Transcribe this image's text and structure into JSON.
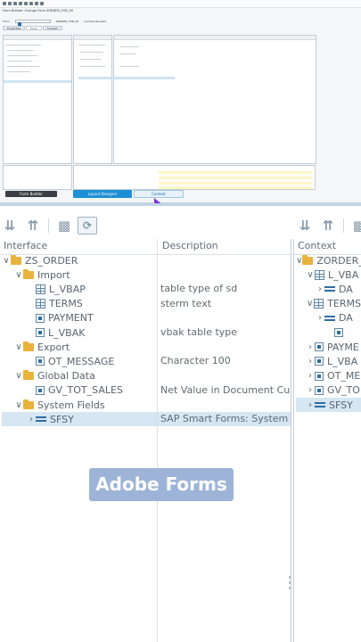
{
  "mini": {
    "title": "Form Builder: Change Form ZORDER_FOR_SS",
    "form_label": "Form",
    "form_value": "ZORDER_FOR_SS",
    "status": "Inactive Revised",
    "tabs": [
      "Properties",
      "Form",
      "Context"
    ],
    "buttons": {
      "back": "Form Builder",
      "layout": "Layout Designer",
      "context": "Context"
    }
  },
  "toolbar": {
    "interface_icons": [
      "collapse-all-icon",
      "expand-all-icon",
      "binoculars-icon",
      "refresh-icon"
    ],
    "context_icons": [
      "collapse-all-icon",
      "expand-all-icon",
      "binoculars-icon"
    ]
  },
  "columns": {
    "interface": "Interface",
    "description": "Description",
    "context": "Context"
  },
  "interface_tree": [
    {
      "label": "ZS_ORDER",
      "icon": "folder",
      "level": 0,
      "expander": "chevron-down",
      "description": ""
    },
    {
      "label": "Import",
      "icon": "folder",
      "level": 1,
      "expander": "chevron-down",
      "description": ""
    },
    {
      "label": "L_VBAP",
      "icon": "table",
      "level": 2,
      "expander": "",
      "description": "table type of sd"
    },
    {
      "label": "TERMS",
      "icon": "table",
      "level": 2,
      "expander": "",
      "description": "sterm text"
    },
    {
      "label": "PAYMENT",
      "icon": "field",
      "level": 2,
      "expander": "",
      "description": ""
    },
    {
      "label": "L_VBAK",
      "icon": "field",
      "level": 2,
      "expander": "",
      "description": "vbak table type"
    },
    {
      "label": "Export",
      "icon": "folder",
      "level": 1,
      "expander": "chevron-down",
      "description": ""
    },
    {
      "label": "OT_MESSAGE",
      "icon": "field",
      "level": 2,
      "expander": "",
      "description": "Character 100"
    },
    {
      "label": "Global Data",
      "icon": "folder",
      "level": 1,
      "expander": "chevron-down",
      "description": ""
    },
    {
      "label": "GV_TOT_SALES",
      "icon": "field",
      "level": 2,
      "expander": "",
      "description": "Net Value in Document Currency"
    },
    {
      "label": "System Fields",
      "icon": "folder",
      "level": 1,
      "expander": "chevron-down",
      "description": ""
    },
    {
      "label": "SFSY",
      "icon": "structure",
      "level": 2,
      "expander": "chevron-right",
      "description": "SAP Smart Forms: System Fields",
      "selected": true
    }
  ],
  "context_tree": [
    {
      "label": "ZORDER_",
      "icon": "folder",
      "level": 0,
      "expander": "chevron-down"
    },
    {
      "label": "L_VBA",
      "icon": "table",
      "level": 1,
      "expander": "chevron-down"
    },
    {
      "label": "DA",
      "icon": "structure",
      "level": 2,
      "expander": "chevron-right"
    },
    {
      "label": "TERMS",
      "icon": "table",
      "level": 1,
      "expander": "chevron-down"
    },
    {
      "label": "DA",
      "icon": "structure",
      "level": 2,
      "expander": "chevron-right"
    },
    {
      "label": "",
      "icon": "field",
      "level": 3,
      "expander": ""
    },
    {
      "label": "PAYME",
      "icon": "field",
      "level": 1,
      "expander": "chevron-right"
    },
    {
      "label": "L_VBA",
      "icon": "field",
      "level": 1,
      "expander": "chevron-right"
    },
    {
      "label": "OT_ME",
      "icon": "field",
      "level": 1,
      "expander": "chevron-right"
    },
    {
      "label": "GV_TO",
      "icon": "field",
      "level": 1,
      "expander": "chevron-right"
    },
    {
      "label": "SFSY",
      "icon": "structure",
      "level": 1,
      "expander": "chevron-right",
      "selected": true
    }
  ],
  "overlay": {
    "caption": "Adobe Forms"
  },
  "colors": {
    "selection": "#d6e6f2",
    "folder": "#e8b33c",
    "field": "#2f6da3",
    "badge": "#9db4d8"
  }
}
